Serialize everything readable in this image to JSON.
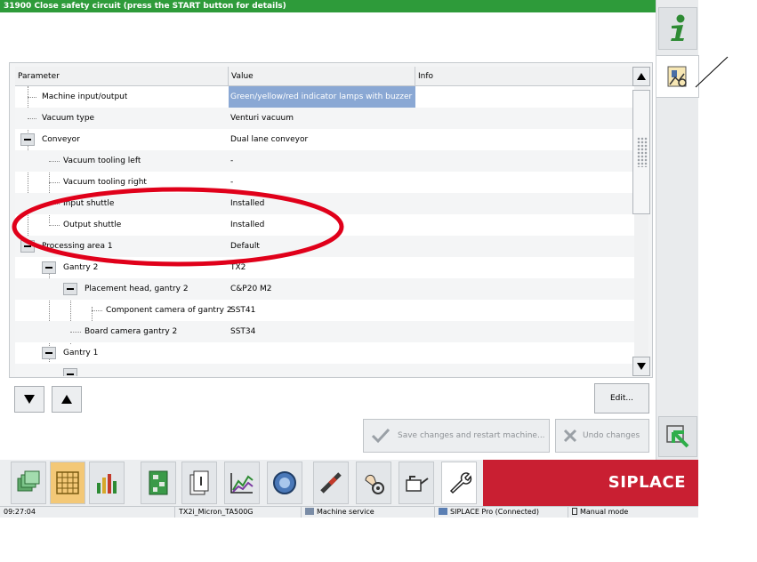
{
  "status": {
    "message": "31900 Close safety circuit (press the START button for details)"
  },
  "table": {
    "headers": {
      "parameter": "Parameter",
      "value": "Value",
      "info": "Info"
    },
    "rows": [
      {
        "parameter": "Machine input/output",
        "value": "Green/yellow/red indicator lamps with buzzer",
        "info": ""
      },
      {
        "parameter": "Vacuum type",
        "value": "Venturi vacuum",
        "info": ""
      },
      {
        "parameter": "Conveyor",
        "value": "Dual lane conveyor",
        "info": ""
      },
      {
        "parameter": "Vacuum tooling left",
        "value": "-",
        "info": ""
      },
      {
        "parameter": "Vacuum tooling right",
        "value": "-",
        "info": ""
      },
      {
        "parameter": "Input shuttle",
        "value": "Installed",
        "info": ""
      },
      {
        "parameter": "Output shuttle",
        "value": "Installed",
        "info": ""
      },
      {
        "parameter": "Processing area 1",
        "value": "Default",
        "info": ""
      },
      {
        "parameter": "Gantry 2",
        "value": "TX2",
        "info": ""
      },
      {
        "parameter": "Placement head, gantry 2",
        "value": "C&P20 M2",
        "info": ""
      },
      {
        "parameter": "Component camera of gantry 2",
        "value": "SST41",
        "info": ""
      },
      {
        "parameter": "Board camera gantry 2",
        "value": "SST34",
        "info": ""
      },
      {
        "parameter": "Gantry 1",
        "value": "",
        "info": ""
      }
    ]
  },
  "buttons": {
    "edit": "Edit...",
    "save": "Save changes and restart machine...",
    "undo": "Undo changes"
  },
  "brand": {
    "logo": "SIPLACE"
  },
  "footer": {
    "time": "09:27:04",
    "machine": "TX2i_Micron_TA500G",
    "mode_service": "Machine service",
    "connection": "SIPLACE Pro (Connected)",
    "operation": "Manual mode"
  },
  "colors": {
    "status_green": "#2e9b3a",
    "selection_blue": "#8aa8d4",
    "brand_red": "#c91f32",
    "annotation_red": "#e0001a"
  },
  "icons": [
    "info-icon",
    "parameters-icon",
    "next-arrow-icon",
    "scroll-up-icon",
    "scroll-down-icon",
    "arrow-down-icon",
    "arrow-up-icon",
    "checkmark-icon",
    "undo-x-icon",
    "documents-icon",
    "grid-icon",
    "bar-chart-icon",
    "circuit-board-icon",
    "feeder-icon",
    "trend-chart-icon",
    "camera-icon",
    "nozzle-icon",
    "service-hand-icon",
    "oil-can-icon",
    "wrench-icon"
  ]
}
